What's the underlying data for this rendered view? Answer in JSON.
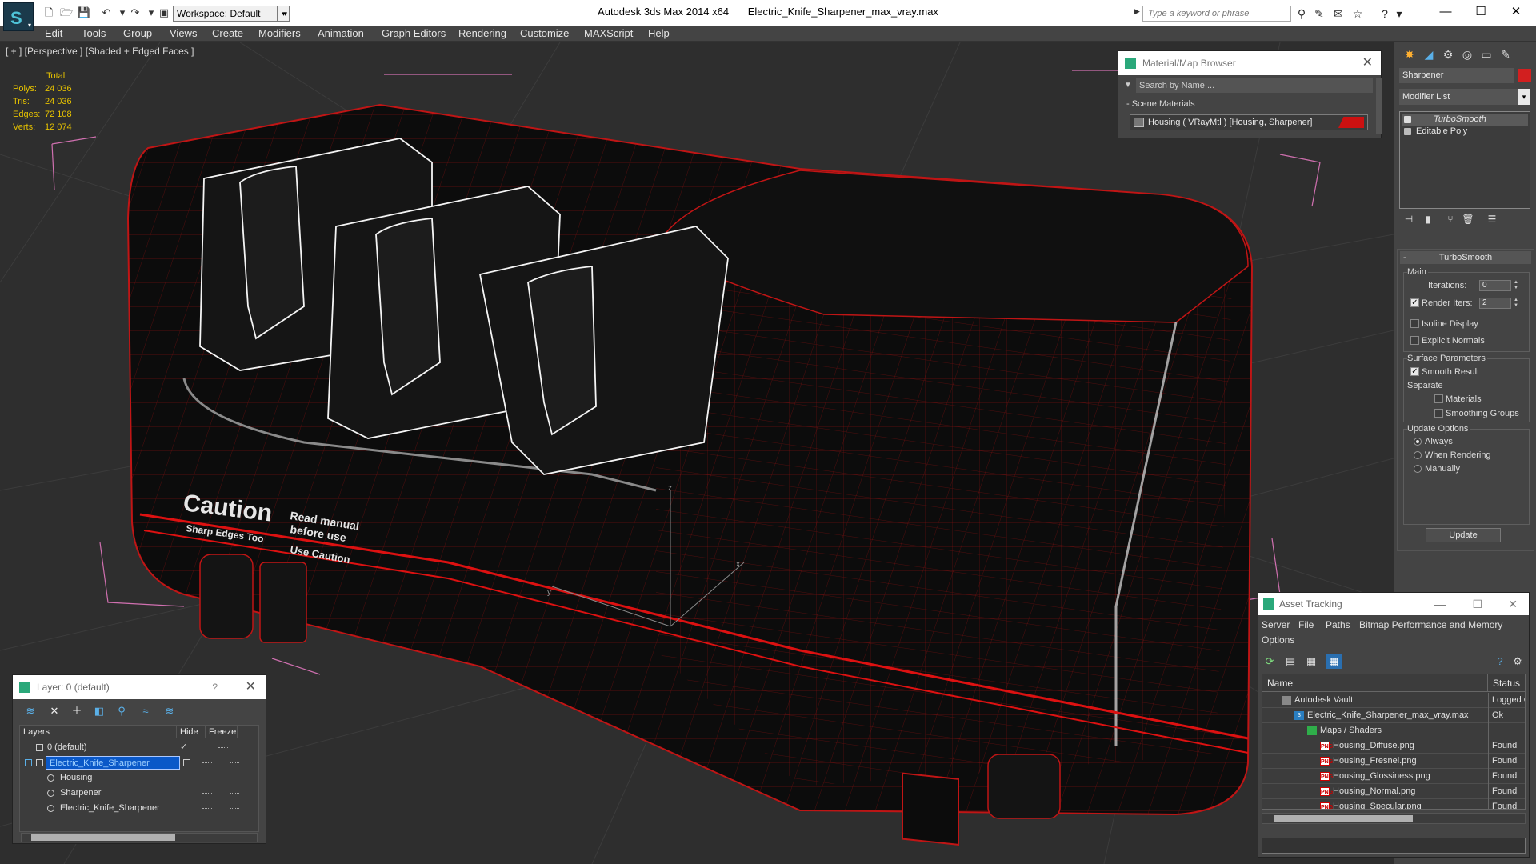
{
  "window": {
    "app_name": "Autodesk 3ds Max  2014 x64",
    "file_name": "Electric_Knife_Sharpener_max_vray.max",
    "workspace": "Workspace: Default",
    "search_placeholder": "Type a keyword or phrase"
  },
  "menu": [
    "Edit",
    "Tools",
    "Group",
    "Views",
    "Create",
    "Modifiers",
    "Animation",
    "Graph Editors",
    "Rendering",
    "Customize",
    "MAXScript",
    "Help"
  ],
  "viewport": {
    "label": "[ + ] [Perspective ] [Shaded + Edged Faces ]",
    "stats": {
      "header": "Total",
      "rows": [
        {
          "label": "Polys:",
          "value": "24 036"
        },
        {
          "label": "Tris:",
          "value": "24 036"
        },
        {
          "label": "Edges:",
          "value": "72 108"
        },
        {
          "label": "Verts:",
          "value": "12 074"
        }
      ]
    },
    "decal": {
      "heading": "Caution",
      "line1": "Read manual",
      "line2": "before use",
      "line3": "Sharp Edges Too",
      "line4": "Use Caution"
    },
    "axis_labels": {
      "z": "z",
      "x": "x",
      "y": "y"
    }
  },
  "material_browser": {
    "title": "Material/Map Browser",
    "search_placeholder": "Search by Name ...",
    "section": "- Scene Materials",
    "row": "Housing  ( VRayMtl ) [Housing, Sharpener]",
    "swatch_color": "#cc1111"
  },
  "command_panel": {
    "object_name": "Sharpener",
    "object_color": "#d21f1f",
    "modifier_list": "Modifier List",
    "stack": [
      "TurboSmooth",
      "Editable Poly"
    ],
    "rollout_title": "TurboSmooth",
    "main_group": "Main",
    "iterations_label": "Iterations:",
    "iterations_value": "0",
    "render_iters_label": "Render Iters:",
    "render_iters_value": "2",
    "render_iters_checked": true,
    "isoline_label": "Isoline Display",
    "explicit_label": "Explicit Normals",
    "surface_group": "Surface Parameters",
    "smooth_result_label": "Smooth Result",
    "separate_label": "Separate",
    "materials_label": "Materials",
    "smoothing_label": "Smoothing Groups",
    "update_group": "Update Options",
    "always_label": "Always",
    "when_rendering_label": "When Rendering",
    "manually_label": "Manually",
    "update_button": "Update"
  },
  "layer_explorer": {
    "title": "Layer: 0 (default)",
    "help": "?",
    "columns": [
      "Layers",
      "Hide",
      "Freeze"
    ],
    "rows": [
      {
        "name": "0 (default)"
      },
      {
        "name": "Electric_Knife_Sharpener"
      },
      {
        "name": "Housing"
      },
      {
        "name": "Sharpener"
      },
      {
        "name": "Electric_Knife_Sharpener"
      }
    ]
  },
  "asset_tracking": {
    "title": "Asset Tracking",
    "menu": [
      "Server",
      "File",
      "Paths",
      "Bitmap Performance and Memory",
      "Options"
    ],
    "columns": [
      "Name",
      "Status"
    ],
    "rows": [
      {
        "name": "Autodesk Vault",
        "status": "Logged O"
      },
      {
        "name": "Electric_Knife_Sharpener_max_vray.max",
        "status": "Ok"
      },
      {
        "name": "Maps / Shaders",
        "status": ""
      },
      {
        "name": "Housing_Diffuse.png",
        "status": "Found"
      },
      {
        "name": "Housing_Fresnel.png",
        "status": "Found"
      },
      {
        "name": "Housing_Glossiness.png",
        "status": "Found"
      },
      {
        "name": "Housing_Normal.png",
        "status": "Found"
      },
      {
        "name": "Housing_Specular.png",
        "status": "Found"
      }
    ]
  }
}
